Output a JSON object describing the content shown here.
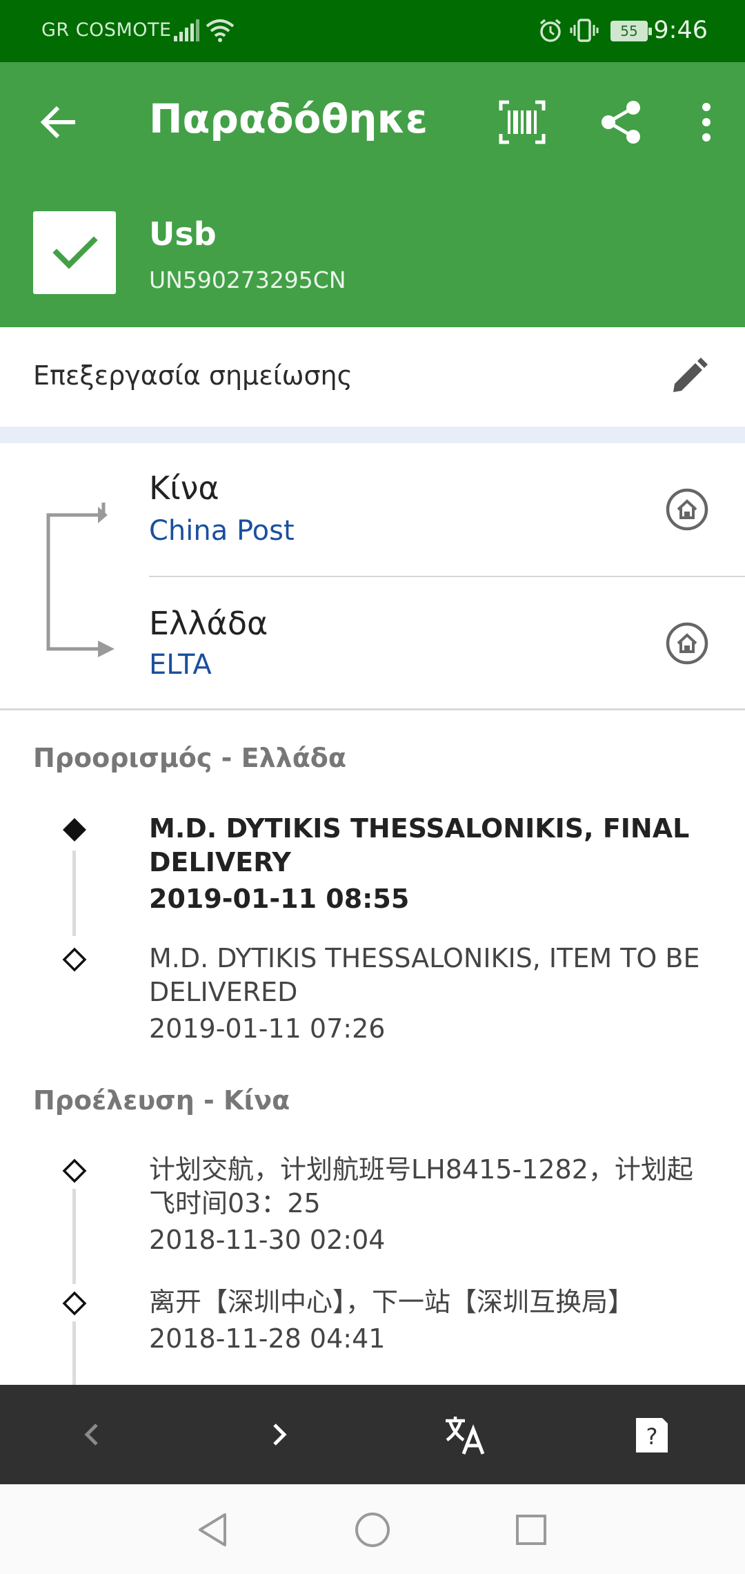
{
  "status_bar": {
    "carrier": "GR COSMOTE",
    "battery": "55",
    "time": "9:46"
  },
  "app_bar": {
    "title": "Παραδόθηκε",
    "item_name": "Usb",
    "tracking_number": "UN590273295CN",
    "icons": [
      "back-arrow-icon",
      "barcode-icon",
      "share-icon",
      "more-vert-icon"
    ]
  },
  "note": {
    "label": "Επεξεργασία σημείωσης"
  },
  "route": {
    "origin": {
      "country": "Κίνα",
      "carrier": "China Post"
    },
    "destination": {
      "country": "Ελλάδα",
      "carrier": "ELTA"
    }
  },
  "destination_section": {
    "title": "Προορισμός - Ελλάδα",
    "events": [
      {
        "description": "M.D. DYTIKIS THESSALONIKIS, FINAL DELIVERY",
        "time": "2019-01-11 08:55",
        "latest": true
      },
      {
        "description": "M.D. DYTIKIS THESSALONIKIS, ITEM TO BE DELIVERED",
        "time": "2019-01-11 07:26",
        "latest": false
      }
    ]
  },
  "origin_section": {
    "title": "Προέλευση - Κίνα",
    "events": [
      {
        "description": "计划交航，计划航班号LH8415-1282，计划起飞时间03：25",
        "time": "2018-11-30 02:04"
      },
      {
        "description": "离开【深圳中心】，下一站【深圳互换局】",
        "time": "2018-11-28 04:41"
      }
    ]
  },
  "colors": {
    "status_bar": "#016c01",
    "app_bar": "#43a047",
    "link_blue": "#1a4f9f",
    "toolbar": "#303030"
  }
}
